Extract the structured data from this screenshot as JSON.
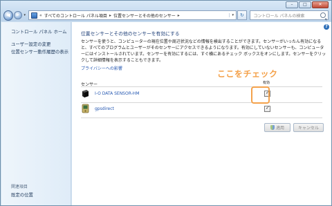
{
  "window": {
    "controls": {
      "minimize": "–",
      "maximize": "□",
      "close": "✕"
    }
  },
  "address": {
    "back_glyph": "◀",
    "forward_glyph": "▶",
    "dropdown_glyph": "▾",
    "overflow": "«",
    "crumbs": [
      "すべてのコントロール パネル項目",
      "位置センサーとその他のセンサー"
    ],
    "crumb_sep": "▸",
    "refresh_glyph": "↻"
  },
  "search": {
    "placeholder": "コントロール パネルの検索"
  },
  "sidebar": {
    "home": "コントロール パネル ホーム",
    "links": [
      "ユーザー設定の変更",
      "位置センサー動作履歴の表示"
    ],
    "see_also_title": "関連項目",
    "see_also": [
      "既定の位置"
    ]
  },
  "main": {
    "help": "?",
    "title": "位置センサーとその他のセンサーを有効にする",
    "description": "センサーを使うと、コンピューターの現在位置や周辺状況などの情報を検出することができます。センサーがいったん有効になると、すべてのプログラムとユーザーがそのセンサーにアクセスできるようになります。有効にしていないセンサーも、コンピューターにはインストールされています。センサーを有効にするには、すぐ横にあるチェック ボックスをオンにします。センサーをクリックして詳細情報を表示することもできます。",
    "privacy_link": "プライバシーへの影響",
    "annotation": "ここをチェック",
    "columns": {
      "sensor": "センサー",
      "enabled": "有効"
    },
    "sensors": [
      {
        "name": "I-O DATA SENSOR-HM",
        "enabled": true
      },
      {
        "name": "gpsdirect",
        "enabled": true
      }
    ],
    "buttons": {
      "apply": "適用",
      "cancel": "キャンセル"
    }
  }
}
